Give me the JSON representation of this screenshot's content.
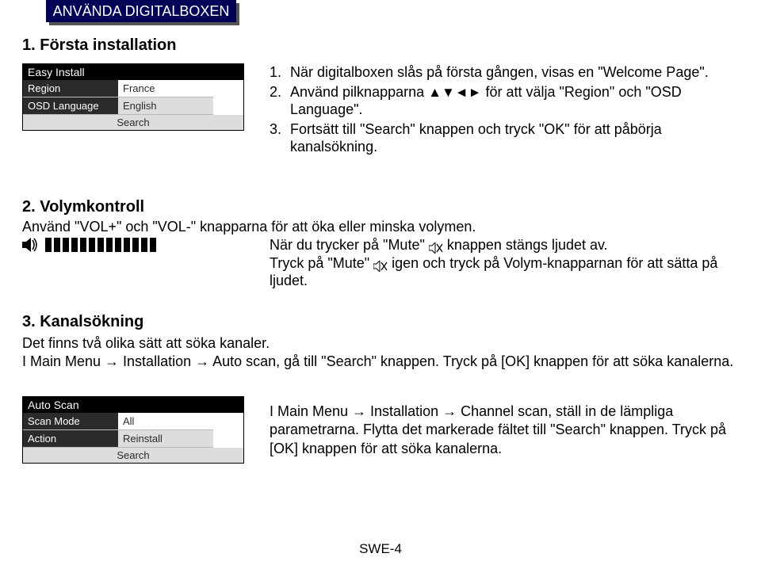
{
  "tab_title": "ANVÄNDA DIGITALBOXEN",
  "section1": {
    "heading": "1. Första installation",
    "panel": {
      "title": "Easy Install",
      "rows": [
        {
          "label": "Region",
          "value": "France"
        },
        {
          "label": "OSD Language",
          "value": "English"
        }
      ],
      "footer": "Search"
    },
    "items": [
      {
        "num": "1.",
        "text": "När digitalboxen slås på första gången, visas en \"Welcome Page\"."
      },
      {
        "num": "2.",
        "text_pre": "Använd pilknapparna ",
        "arrows": "▲▼◄►",
        "text_post": " för att välja \"Region\" och \"OSD Language\"."
      },
      {
        "num": "3.",
        "text": "Fortsätt till \"Search\" knappen och tryck \"OK\" för att påbörja kanalsökning."
      }
    ]
  },
  "section2": {
    "heading": "2. Volymkontroll",
    "line1": "Använd \"VOL+\" och \"VOL-\" knapparna för att öka eller minska volymen.",
    "para_a_pre": "När du trycker på \"Mute\" ",
    "para_a_post": " knappen stängs ljudet av.",
    "para_b_pre": "Tryck på \"Mute\" ",
    "para_b_post": " igen och tryck på Volym-knapparnan för att sätta på ljudet."
  },
  "section3": {
    "heading": "3. Kanalsökning",
    "para1": "Det finns två olika sätt att söka kanaler.",
    "para2": "I Main Menu → Installation → Auto scan, gå till \"Search\" knappen. Tryck på [OK] knappen för att söka kanalerna.",
    "panel": {
      "title": "Auto Scan",
      "rows": [
        {
          "label": "Scan Mode",
          "value": "All"
        },
        {
          "label": "Action",
          "value": "Reinstall"
        }
      ],
      "footer": "Search"
    },
    "right": "I Main Menu → Installation → Channel scan, ställ in de lämpliga parametrarna. Flytta det markerade fältet till \"Search\" knappen. Tryck på [OK] knappen för att söka kanalerna."
  },
  "page_number": "SWE-4"
}
